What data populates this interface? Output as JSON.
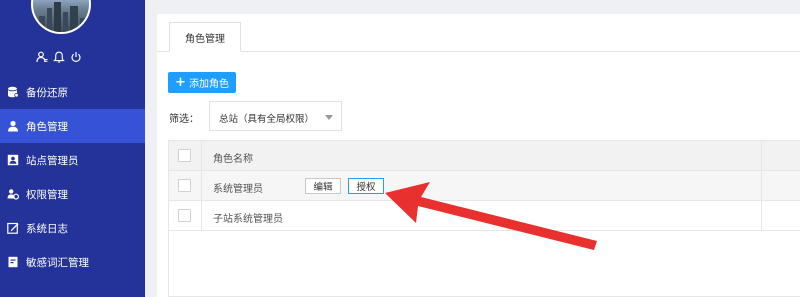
{
  "sidebar": {
    "user_icons": [
      "user-card-icon",
      "bell-icon",
      "power-icon"
    ],
    "items": [
      {
        "label": "备份还原",
        "icon": "database-icon",
        "active": false
      },
      {
        "label": "角色管理",
        "icon": "user-icon",
        "active": true
      },
      {
        "label": "站点管理员",
        "icon": "id-card-icon",
        "active": false
      },
      {
        "label": "权限管理",
        "icon": "user-group-icon",
        "active": false
      },
      {
        "label": "系统日志",
        "icon": "edit-icon",
        "active": false
      },
      {
        "label": "敏感词汇管理",
        "icon": "book-icon",
        "active": false
      }
    ]
  },
  "main": {
    "tab": "角色管理",
    "add_button": "添加角色",
    "filter_label": "筛选：",
    "filter_value": "总站（具有全局权限）",
    "table": {
      "header": "角色名称",
      "rows": [
        {
          "name": "系统管理员",
          "actions": [
            "编辑",
            "授权"
          ]
        },
        {
          "name": "子站系统管理员",
          "actions": []
        }
      ]
    }
  },
  "colors": {
    "sidebar_bg": "#23339a",
    "sidebar_active": "#3653d8",
    "primary_button": "#1e9fff",
    "annotation_arrow": "#e8312f"
  }
}
